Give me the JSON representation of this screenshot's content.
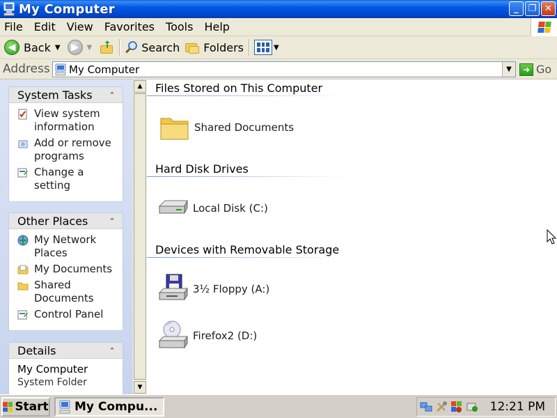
{
  "window": {
    "title": "My Computer",
    "buttons": {
      "minimize": "_",
      "maximize": "❐",
      "close": "✕"
    }
  },
  "menubar": {
    "items": [
      "File",
      "Edit",
      "View",
      "Favorites",
      "Tools",
      "Help"
    ]
  },
  "toolbar": {
    "back_label": "Back",
    "search_label": "Search",
    "folders_label": "Folders"
  },
  "address": {
    "label": "Address",
    "value": "My Computer",
    "go_label": "Go"
  },
  "taskpane": {
    "system_tasks": {
      "title": "System Tasks",
      "items": [
        {
          "label": "View system information",
          "icon": "system-info-icon"
        },
        {
          "label": "Add or remove programs",
          "icon": "add-remove-programs-icon"
        },
        {
          "label": "Change a setting",
          "icon": "control-panel-icon"
        }
      ]
    },
    "other_places": {
      "title": "Other Places",
      "items": [
        {
          "label": "My Network Places",
          "icon": "network-places-icon"
        },
        {
          "label": "My Documents",
          "icon": "my-documents-icon"
        },
        {
          "label": "Shared Documents",
          "icon": "folder-icon"
        },
        {
          "label": "Control Panel",
          "icon": "control-panel-icon"
        }
      ]
    },
    "details": {
      "title": "Details",
      "name": "My Computer",
      "type": "System Folder"
    }
  },
  "content": {
    "groups": [
      {
        "title": "Files Stored on This Computer",
        "items": [
          {
            "label": "Shared Documents",
            "icon": "folder-icon"
          }
        ]
      },
      {
        "title": "Hard Disk Drives",
        "items": [
          {
            "label": "Local Disk (C:)",
            "icon": "hard-disk-icon"
          }
        ]
      },
      {
        "title": "Devices with Removable Storage",
        "items": [
          {
            "label": "3½ Floppy (A:)",
            "icon": "floppy-drive-icon"
          },
          {
            "label": "Firefox2 (D:)",
            "icon": "cd-drive-icon"
          }
        ]
      }
    ]
  },
  "taskbar": {
    "start_label": "Start",
    "window_label": "My Compu...",
    "clock": "12:21 PM"
  },
  "colors": {
    "titlebar": "#0058e6",
    "chrome": "#ece9d8",
    "taskpane": "#c8d4ef"
  }
}
